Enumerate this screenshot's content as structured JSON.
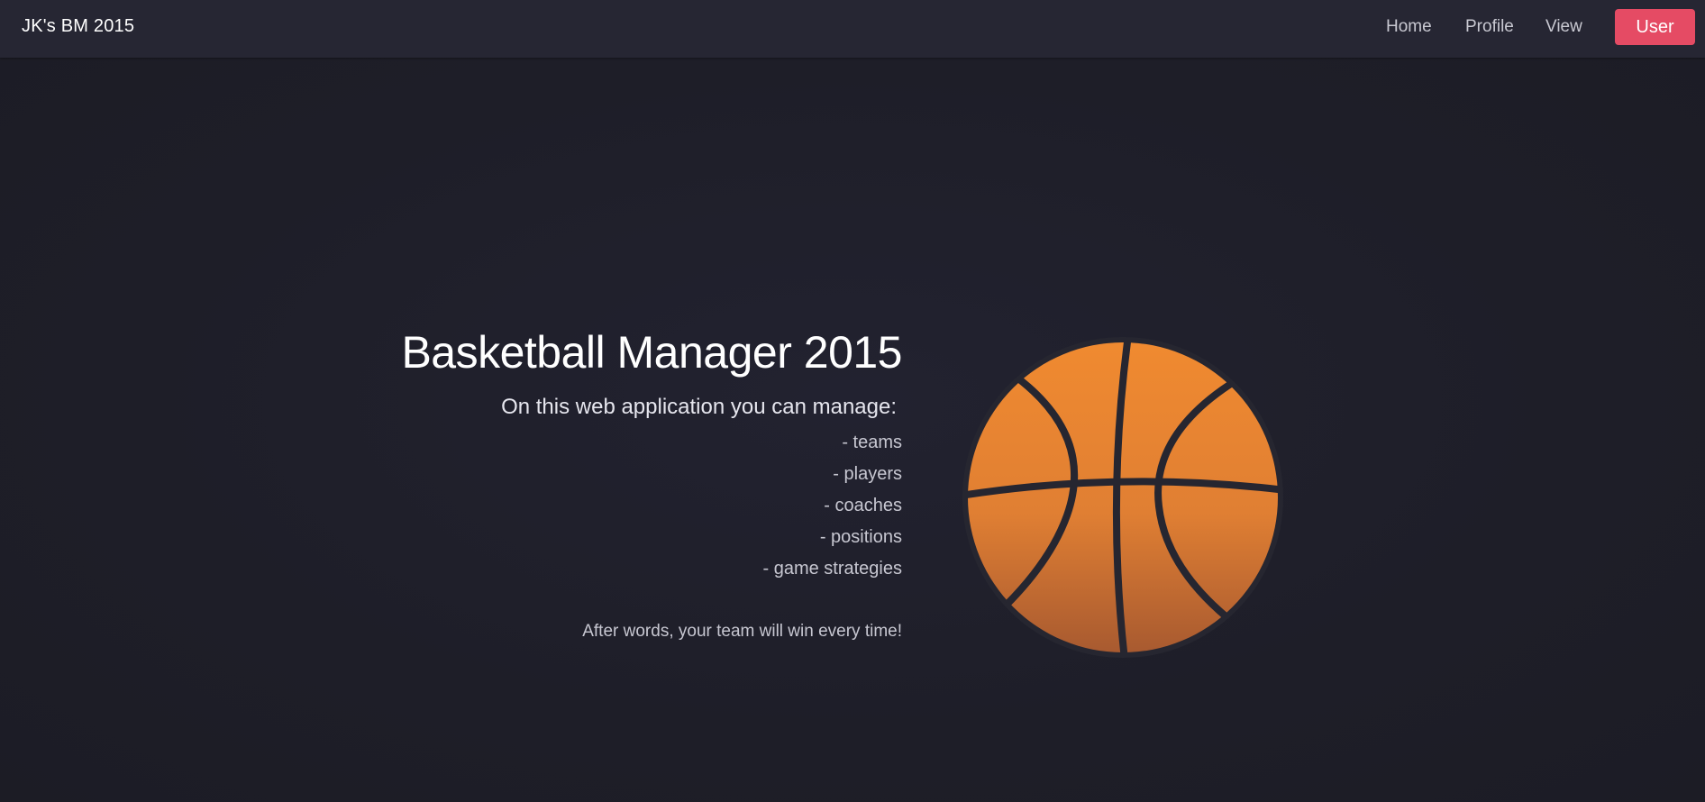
{
  "navbar": {
    "brand": "JK's BM 2015",
    "links": [
      {
        "label": "Home"
      },
      {
        "label": "Profile"
      },
      {
        "label": "View"
      }
    ],
    "user_button": "User"
  },
  "hero": {
    "title": "Basketball Manager 2015",
    "subtitle": "On this web application you can manage:",
    "features": [
      "- teams",
      "- players",
      "- coaches",
      "- positions",
      "- game strategies"
    ],
    "tagline": "After words, your team will win every time!"
  },
  "colors": {
    "background": "#1f1f29",
    "navbar": "#262633",
    "accent": "#e54b64",
    "ball_top": "#f08a30",
    "ball_bottom": "#a85a30",
    "ball_lines": "#262630"
  },
  "icons": {
    "hero_image": "basketball-icon"
  }
}
